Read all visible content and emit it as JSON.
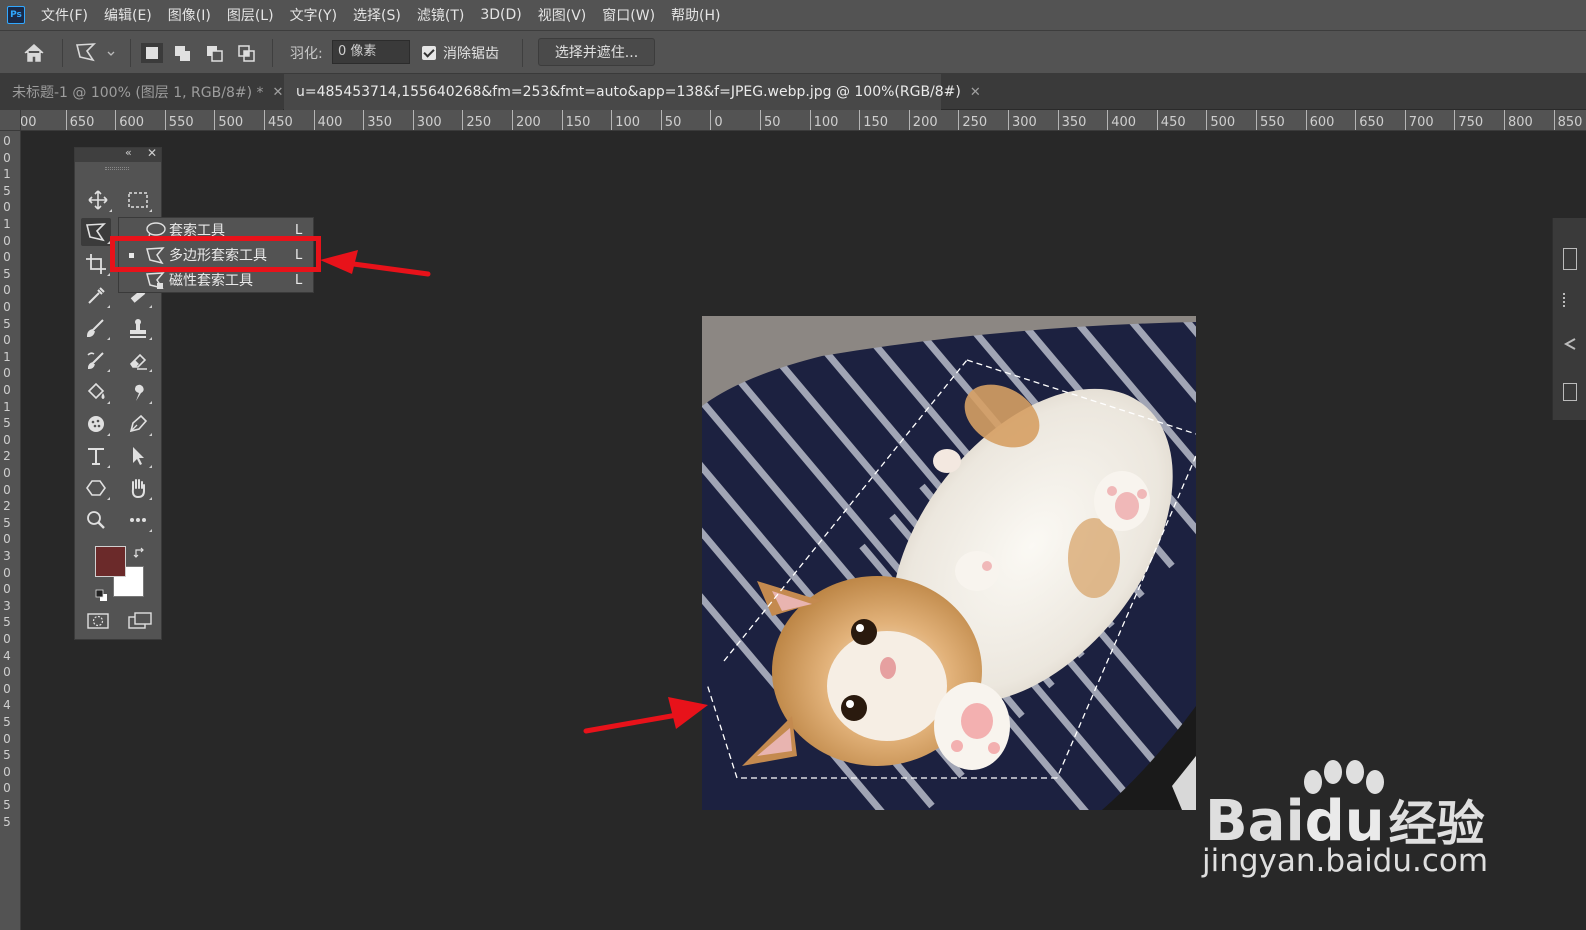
{
  "app": {
    "logo": "Ps"
  },
  "menu": [
    "文件(F)",
    "编辑(E)",
    "图像(I)",
    "图层(L)",
    "文字(Y)",
    "选择(S)",
    "滤镜(T)",
    "3D(D)",
    "视图(V)",
    "窗口(W)",
    "帮助(H)"
  ],
  "options": {
    "feather_label": "羽化:",
    "feather_value": "0 像素",
    "antialias_label": "消除锯齿",
    "antialias_checked": true,
    "select_mask_label": "选择并遮住..."
  },
  "tabs": [
    {
      "label": "未标题-1 @ 100% (图层 1, RGB/8#) *",
      "active": false
    },
    {
      "label": "u=485453714,155640268&fm=253&fmt=auto&app=138&f=JPEG.webp.jpg @ 100%(RGB/8#)",
      "active": true
    }
  ],
  "ruler_h": [
    "00",
    "650",
    "600",
    "550",
    "500",
    "450",
    "400",
    "350",
    "300",
    "250",
    "200",
    "150",
    "100",
    "50",
    "0",
    "50",
    "100",
    "150",
    "200",
    "250",
    "300",
    "350",
    "400",
    "450",
    "500",
    "550",
    "600",
    "650",
    "700",
    "750",
    "800",
    "850"
  ],
  "ruler_v": [
    "0",
    "0",
    "1",
    "5",
    "0",
    "1",
    "0",
    "0",
    "5",
    "0",
    "0",
    "5",
    "0",
    "1",
    "0",
    "0",
    "1",
    "5",
    "0",
    "2",
    "0",
    "0",
    "2",
    "5",
    "0",
    "3",
    "0",
    "0",
    "3",
    "5",
    "0",
    "4",
    "0",
    "0",
    "4",
    "5",
    "0",
    "5",
    "0",
    "0",
    "5",
    "5"
  ],
  "flyout": [
    {
      "label": "套索工具",
      "key": "L",
      "icon": "lasso-icon",
      "selected": false
    },
    {
      "label": "多边形套索工具",
      "key": "L",
      "icon": "polygonal-lasso-icon",
      "selected": true
    },
    {
      "label": "磁性套索工具",
      "key": "L",
      "icon": "magnetic-lasso-icon",
      "selected": false
    }
  ],
  "colors": {
    "foreground": "#6b2a2a",
    "background": "#ffffff",
    "highlight": "#e8121a",
    "ui_dark": "#282828"
  },
  "watermark": {
    "brand": "Bai",
    "brand2": "du",
    "suffix": "经验",
    "url": "jingyan.baidu.com"
  }
}
